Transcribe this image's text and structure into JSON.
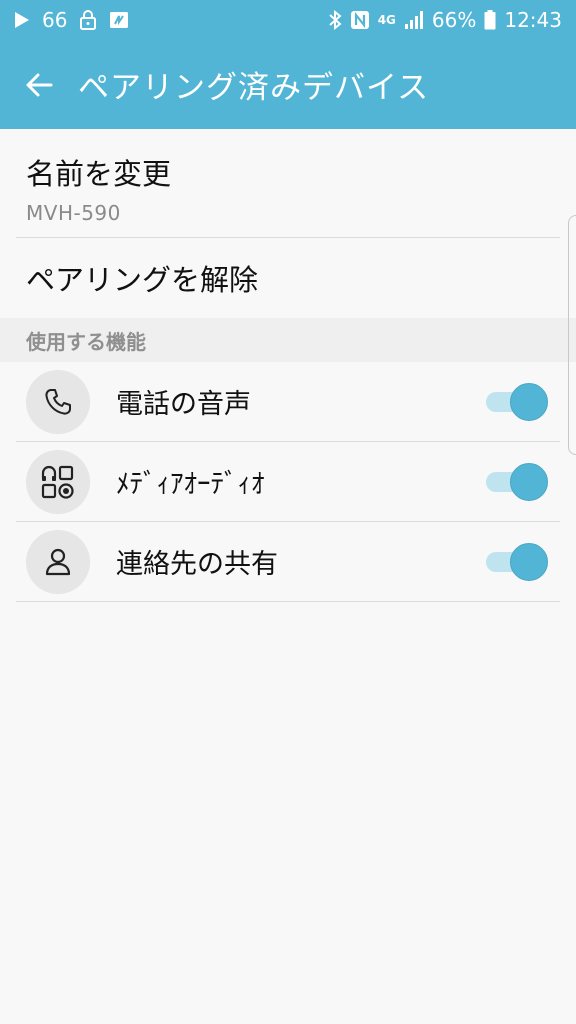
{
  "status_bar": {
    "notification_count": "66",
    "battery_percent": "66%",
    "network": "4G",
    "time": "12:43",
    "icons": [
      "play-icon",
      "lock-icon",
      "media-icon",
      "bluetooth-icon",
      "nfc-icon",
      "signal-icon",
      "battery-icon"
    ]
  },
  "app_bar": {
    "title": "ペアリング済みデバイス"
  },
  "rename": {
    "title": "名前を変更",
    "device_name": "MVH-590"
  },
  "unpair": {
    "title": "ペアリングを解除"
  },
  "features": {
    "header": "使用する機能",
    "items": [
      {
        "label": "電話の音声",
        "icon": "phone-icon",
        "enabled": true
      },
      {
        "label": "ﾒﾃﾞｨｱｵｰﾃﾞｨｵ",
        "icon": "media-audio-icon",
        "enabled": true
      },
      {
        "label": "連絡先の共有",
        "icon": "person-icon",
        "enabled": true
      }
    ]
  },
  "colors": {
    "accent": "#52b5d6",
    "toggle_track": "#bfe3ef",
    "section_bg": "#efefef",
    "page_bg": "#f8f8f8"
  }
}
